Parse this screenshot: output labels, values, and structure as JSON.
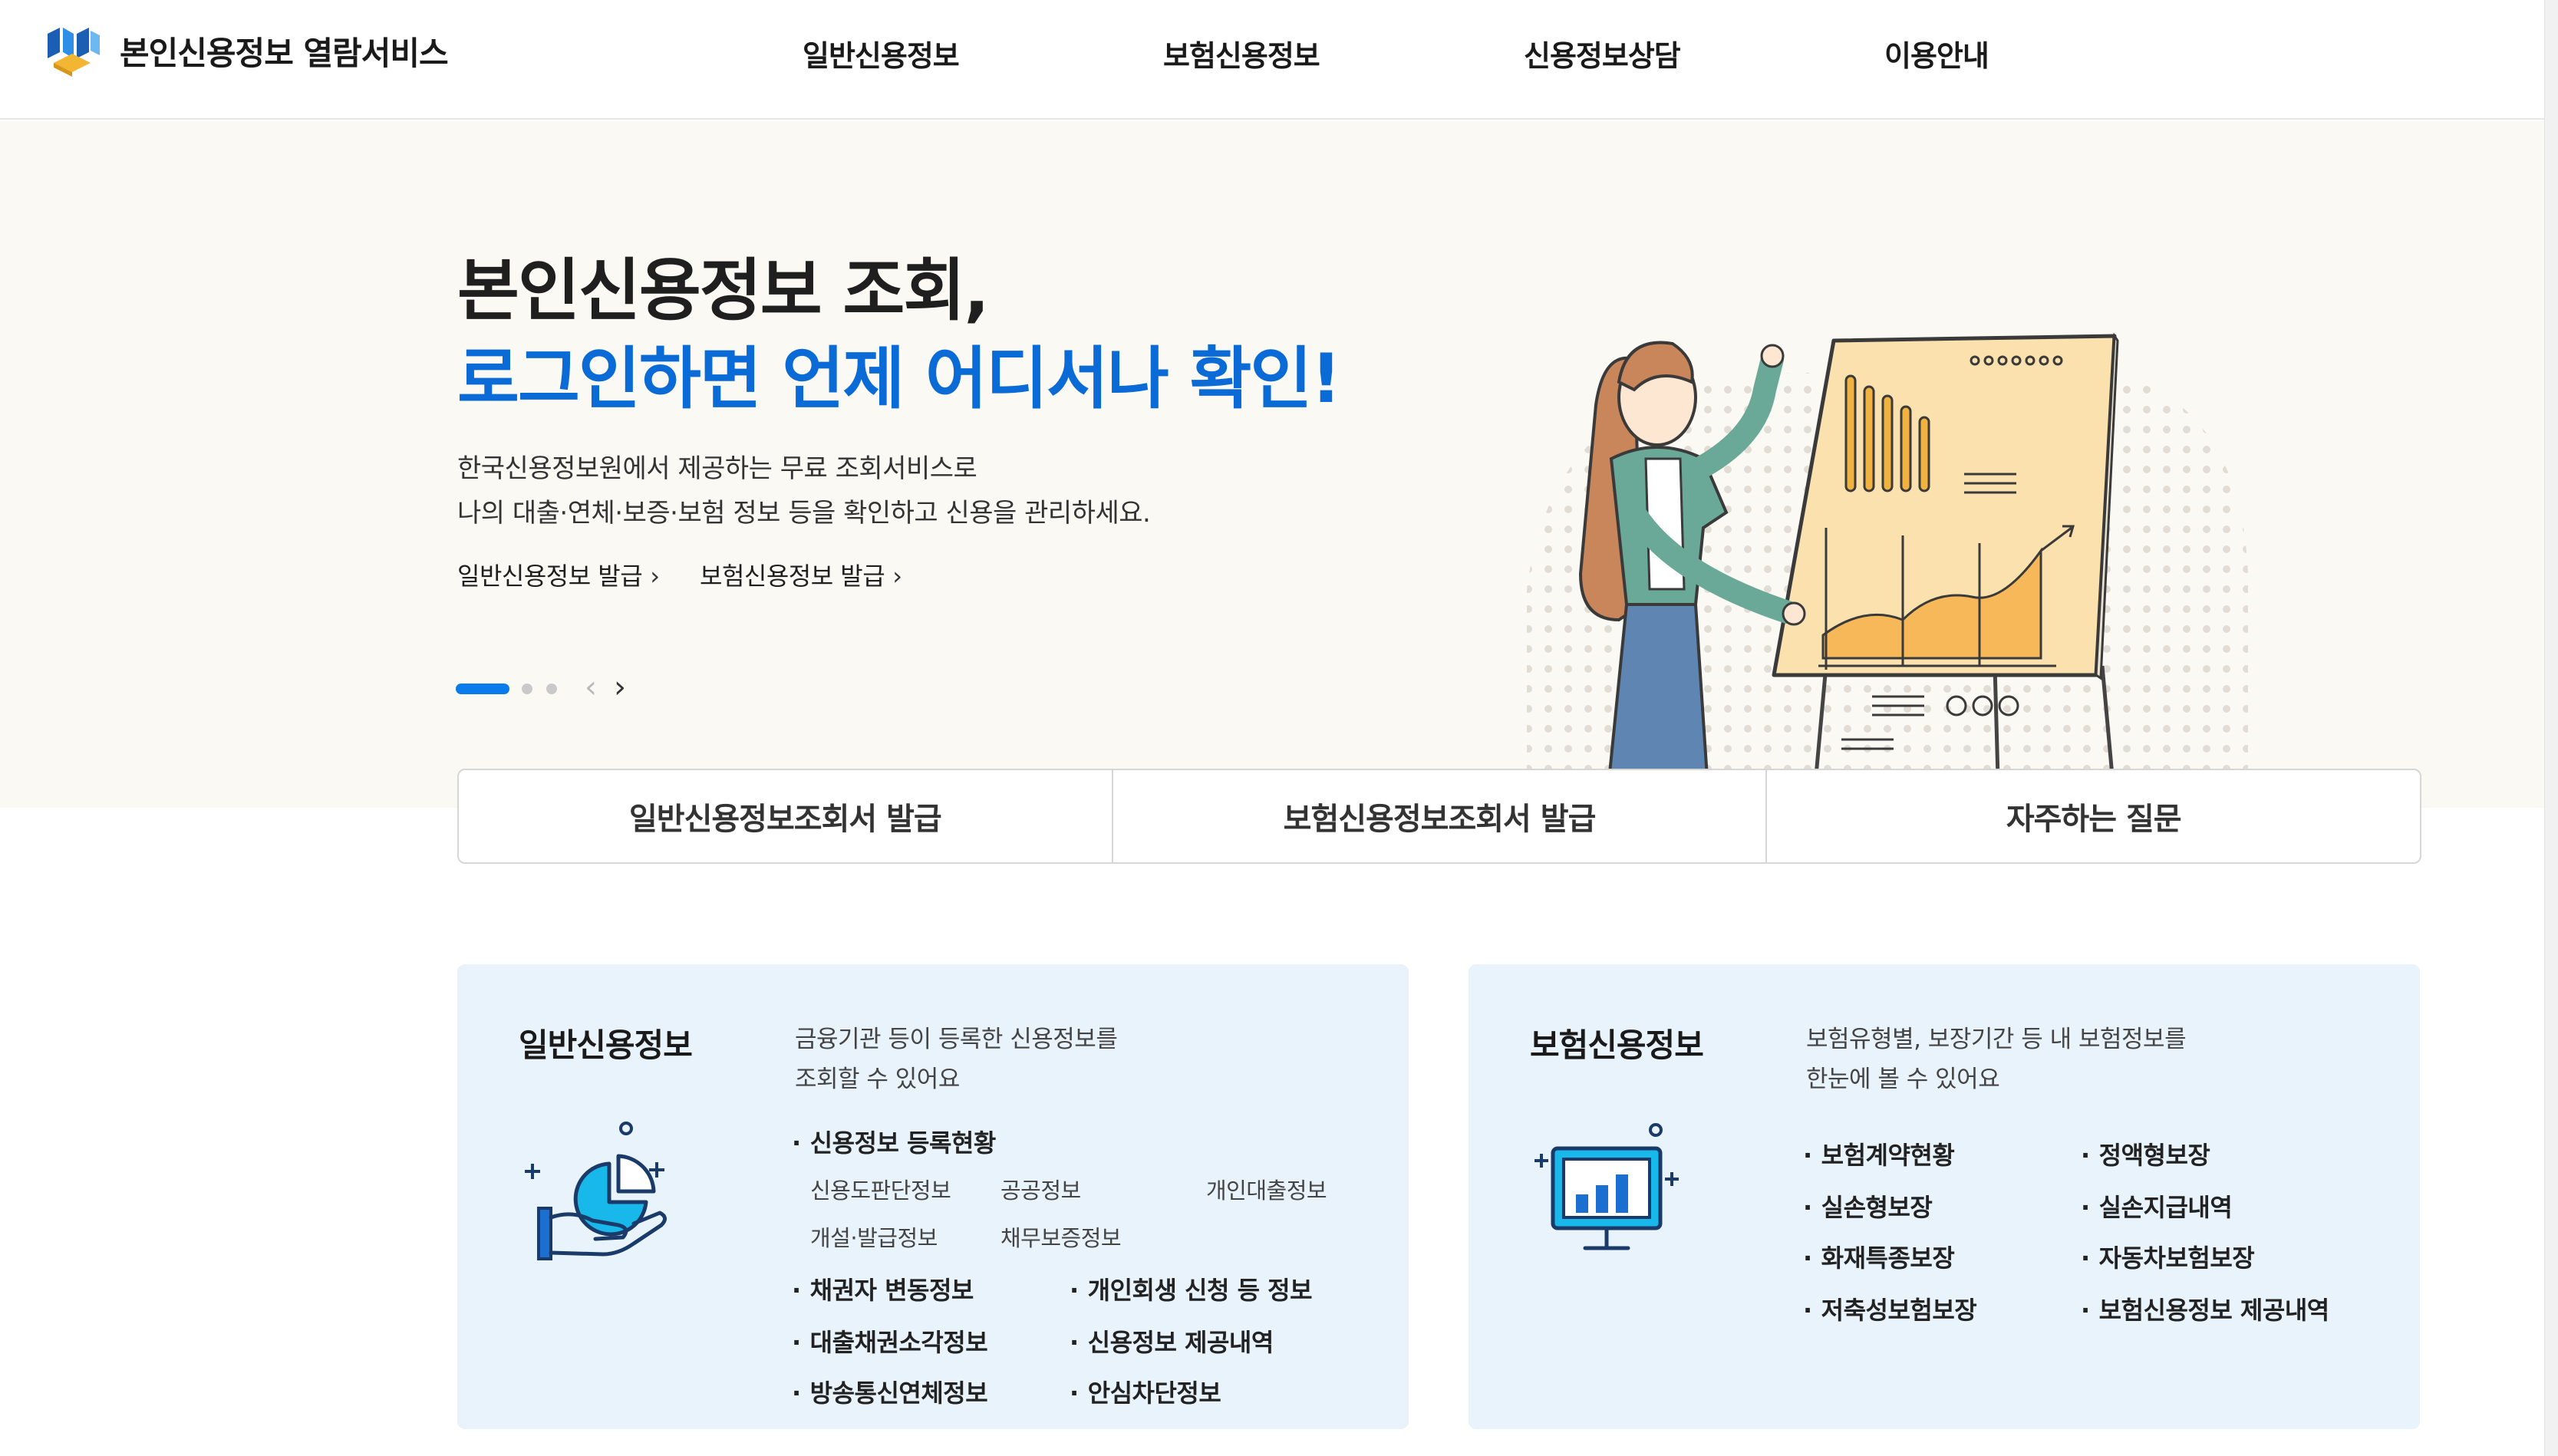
{
  "header": {
    "logo_text": "본인신용정보 열람서비스",
    "nav": [
      "일반신용정보",
      "보험신용정보",
      "신용정보상담",
      "이용안내"
    ]
  },
  "hero": {
    "line1": "본인신용정보 조회,",
    "line2": "로그인하면 언제 어디서나 확인!",
    "desc1": "한국신용정보원에서 제공하는 무료 조회서비스로",
    "desc2": "나의 대출·연체·보증·보험 정보 등을 확인하고 신용을 관리하세요.",
    "link1": "일반신용정보 발급",
    "link2": "보험신용정보 발급",
    "link_chevron": "›",
    "prev": "‹",
    "next": "›"
  },
  "quick": [
    "일반신용정보조회서 발급",
    "보험신용정보조회서 발급",
    "자주하는 질문"
  ],
  "general_card": {
    "title": "일반신용정보",
    "desc1": "금융기관 등이 등록한 신용정보를",
    "desc2": "조회할 수 있어요",
    "main_item": "신용정보 등록현황",
    "sub_items": [
      "신용도판단정보",
      "공공정보",
      "개인대출정보",
      "개설·발급정보",
      "채무보증정보"
    ],
    "items": [
      "채권자 변동정보",
      "개인회생 신청 등 정보",
      "대출채권소각정보",
      "신용정보 제공내역",
      "방송통신연체정보",
      "안심차단정보"
    ]
  },
  "insurance_card": {
    "title": "보험신용정보",
    "desc1": "보험유형별, 보장기간 등 내 보험정보를",
    "desc2": "한눈에 볼 수 있어요",
    "items": [
      "보험계약현황",
      "정액형보장",
      "실손형보장",
      "실손지급내역",
      "화재특종보장",
      "자동차보험보장",
      "저축성보험보장",
      "보험신용정보 제공내역"
    ]
  },
  "colors": {
    "accent": "#0a6bd6",
    "hero_bg": "#fbf9f4",
    "card_bg": "#e8f3fb",
    "icon_blue": "#1a6fd0",
    "icon_cyan": "#19b8ea"
  }
}
